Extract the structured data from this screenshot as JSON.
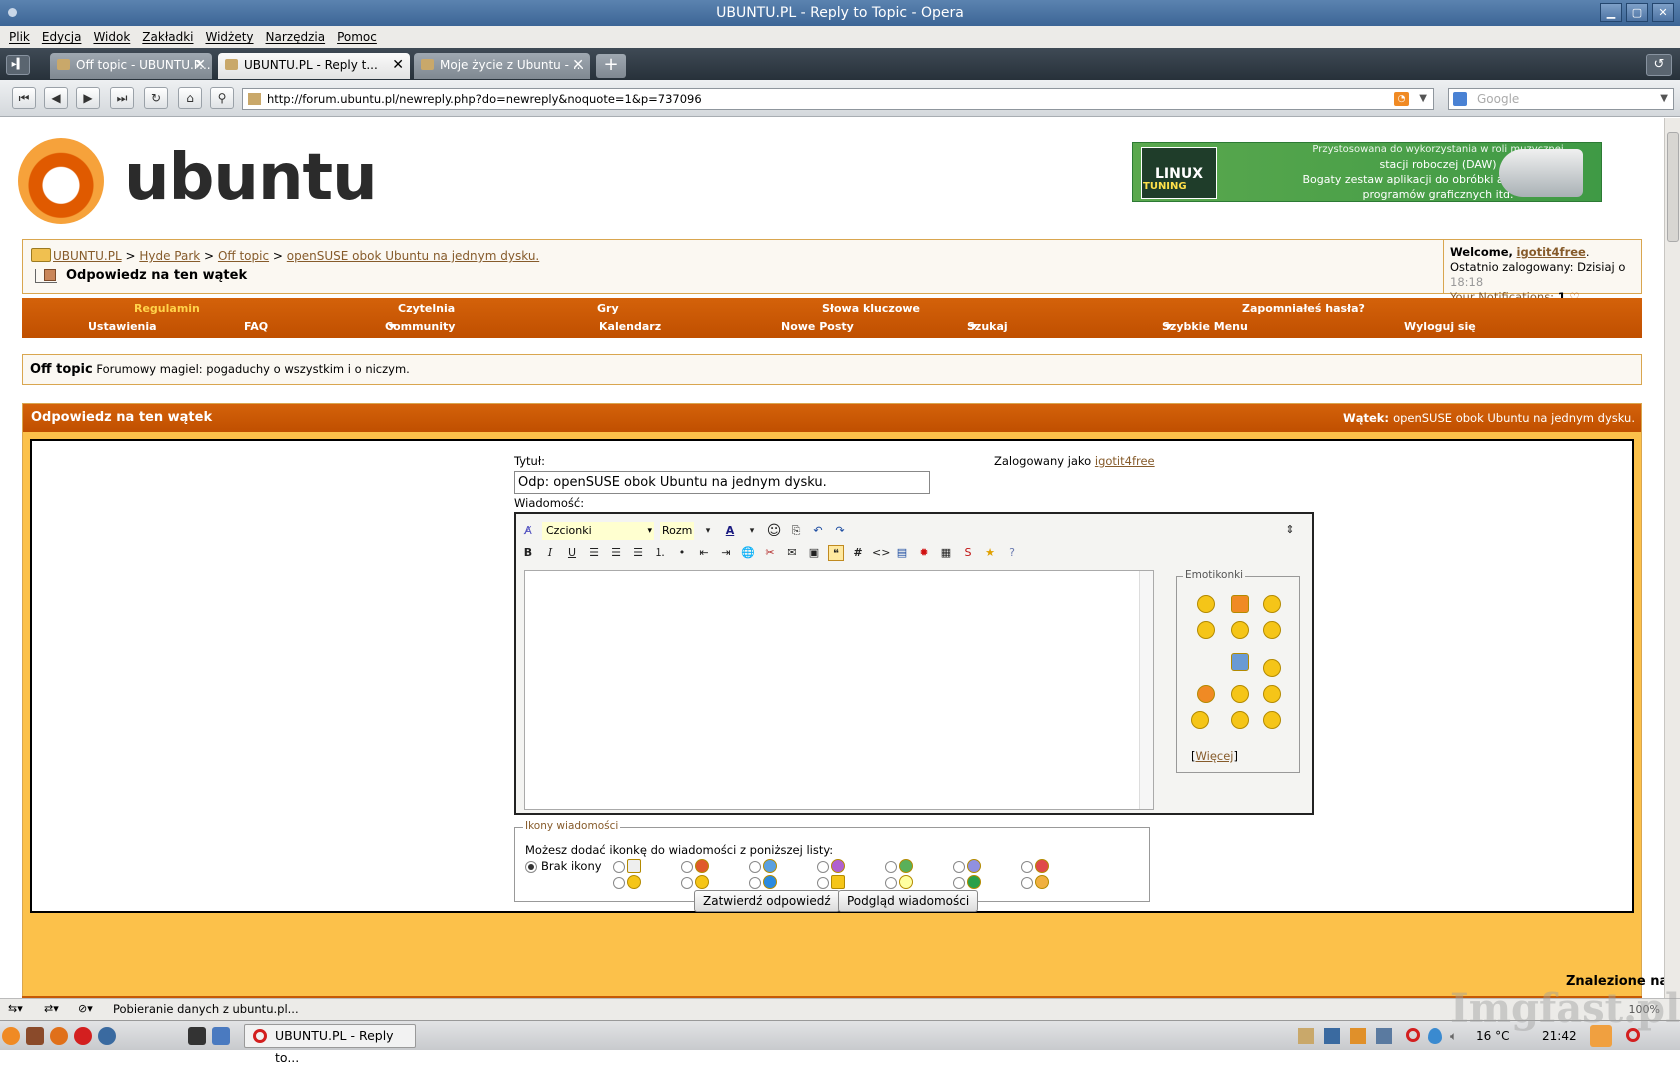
{
  "window": {
    "title": "UBUNTU.PL - Reply to Topic - Opera",
    "buttons": [
      "▁",
      "▢",
      "✕"
    ]
  },
  "menu": [
    "Plik",
    "Edycja",
    "Widok",
    "Zakładki",
    "Widżety",
    "Narzędzia",
    "Pomoc"
  ],
  "tabs": [
    {
      "label": "Off topic - UBUNTU.P...",
      "active": false
    },
    {
      "label": "UBUNTU.PL - Reply t...",
      "active": true
    },
    {
      "label": "Moje życie z Ubuntu - ...",
      "active": false
    }
  ],
  "tab_close": "✕",
  "new_tab": "+",
  "nav": {
    "url": "http://forum.ubuntu.pl/newreply.php?do=newreply&noquote=1&p=737096",
    "search_placeholder": "Google",
    "buttons": [
      "⏮",
      "◀",
      "▶",
      "⏭",
      "↻",
      "⌂",
      "⚲"
    ]
  },
  "logo": {
    "wordmark": "ubuntu"
  },
  "banner": {
    "magazine": "LINUX",
    "magazine_sub": "TUNING",
    "line1": "Przystosowana do wykorzystania w roli muzycznej",
    "line2": "stacji roboczej (DAW)",
    "line3": "Bogaty zestaw aplikacji do obróbki audio i wideo,",
    "line4": "programów graficznych itd."
  },
  "breadcrumb": {
    "items": [
      "UBUNTU.PL",
      "Hyde Park",
      "Off topic",
      "openSUSE obok Ubuntu na jednym dysku."
    ],
    "sep": ">",
    "title": "Odpowiedz na ten wątek"
  },
  "welcome": {
    "label": "Welcome,",
    "user": "igotit4free",
    "dot": ".",
    "last_login_label": "Ostatnio zalogowany: Dzisiaj o",
    "last_login_time": "18:18",
    "notifications_label": "Your Notifications:",
    "notifications_count": "1"
  },
  "navstrip": {
    "row1": [
      "Regulamin",
      "Czytelnia",
      "Gry",
      "Słowa kluczowe",
      "Zapomniałeś hasła?"
    ],
    "row2": [
      "Ustawienia",
      "FAQ",
      "Community",
      "Kalendarz",
      "Nowe Posty",
      "Szukaj",
      "Szybkie Menu",
      "Wyloguj się"
    ]
  },
  "forum": {
    "name": "Off topic",
    "desc": "Forumowy magiel: pogaduchy o wszystkim i o niczym."
  },
  "reply": {
    "header": "Odpowiedz na ten wątek",
    "thread_label": "Wątek:",
    "thread_name": "openSUSE obok Ubuntu na jednym dysku.",
    "title_label": "Tytuł:",
    "title_value": "Odp: openSUSE obok Ubuntu na jednym dysku.",
    "logged_as": "Zalogowany jako",
    "logged_user": "igotit4free",
    "message_label": "Wiadomość:",
    "font_select": "Czcionki",
    "size_select": "Rozm",
    "emoticons_legend": "Emotikonki",
    "emoticons_more": "Więcej",
    "icons_legend": "Ikony wiadomości",
    "icons_desc": "Możesz dodać ikonkę do wiadomości z poniższej listy:",
    "no_icon": "Brak ikony",
    "submit": "Zatwierdź odpowiedź",
    "preview": "Podgląd wiadomości"
  },
  "found_label": "Znalezione na:",
  "status": {
    "text": "Pobieranie danych z ubuntu.pl...",
    "zoom": "100%"
  },
  "taskbar": {
    "task": "UBUNTU.PL - Reply to...",
    "temp": "16 °C",
    "clock": "21:42"
  },
  "watermark": "Imgfast.pl",
  "colors": {
    "accent_orange": "#c65a05",
    "link_brown": "#865b2b",
    "highlight_yellow": "#ffd34a"
  }
}
